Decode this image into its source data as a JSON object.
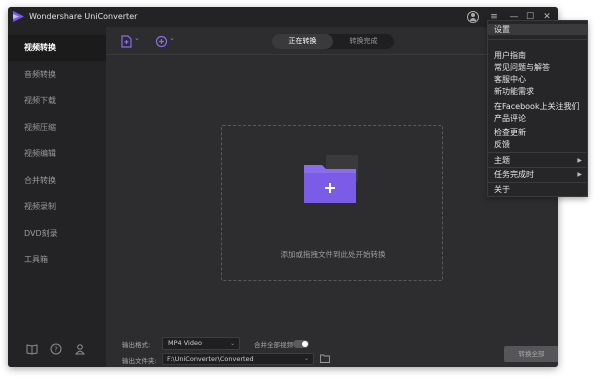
{
  "window": {
    "title": "Wondershare UniConverter"
  },
  "sidebar": {
    "items": [
      {
        "label": "视频转换",
        "active": true
      },
      {
        "label": "音频转换",
        "active": false
      },
      {
        "label": "视频下载",
        "active": false
      },
      {
        "label": "视频压缩",
        "active": false
      },
      {
        "label": "视频编辑",
        "active": false
      },
      {
        "label": "合并转换",
        "active": false
      },
      {
        "label": "视频录制",
        "active": false
      },
      {
        "label": "DVD刻录",
        "active": false
      },
      {
        "label": "工具箱",
        "active": false
      }
    ],
    "footer_icons": [
      "book-icon",
      "help-icon",
      "account-icon"
    ]
  },
  "toolbar": {
    "tabs": [
      {
        "label": "正在转换",
        "active": true
      },
      {
        "label": "转换完成",
        "active": false
      }
    ],
    "icons": [
      "add-file-icon",
      "add-media-icon"
    ]
  },
  "dropzone": {
    "text": "添加或拖拽文件到此处开始转换"
  },
  "bottom": {
    "output_format_label": "输出格式:",
    "output_format_value": "MP4 Video",
    "merge_label": "合并全部视频",
    "merge_enabled": false,
    "output_folder_label": "输出文件夹:",
    "output_folder_value": "F:\\UniConverter\\Converted",
    "convert_all_label": "转换全部"
  },
  "menu": {
    "items": [
      {
        "label": "设置",
        "submenu": false
      },
      {
        "label": "用户指南",
        "submenu": false
      },
      {
        "label": "常见问题与解答",
        "submenu": false
      },
      {
        "label": "客服中心",
        "submenu": false
      },
      {
        "label": "新功能需求",
        "submenu": false
      },
      {
        "label": "在Facebook上关注我们",
        "submenu": false
      },
      {
        "label": "产品评论",
        "submenu": false
      },
      {
        "label": "检查更新",
        "submenu": false
      },
      {
        "label": "反馈",
        "submenu": false
      },
      {
        "label": "主题",
        "submenu": true
      },
      {
        "label": "任务完成时",
        "submenu": true
      },
      {
        "label": "关于",
        "submenu": false
      }
    ]
  },
  "colors": {
    "accent_purple": "#8a6cf0",
    "background": "#2b2b2d",
    "sidebar": "#232325"
  }
}
